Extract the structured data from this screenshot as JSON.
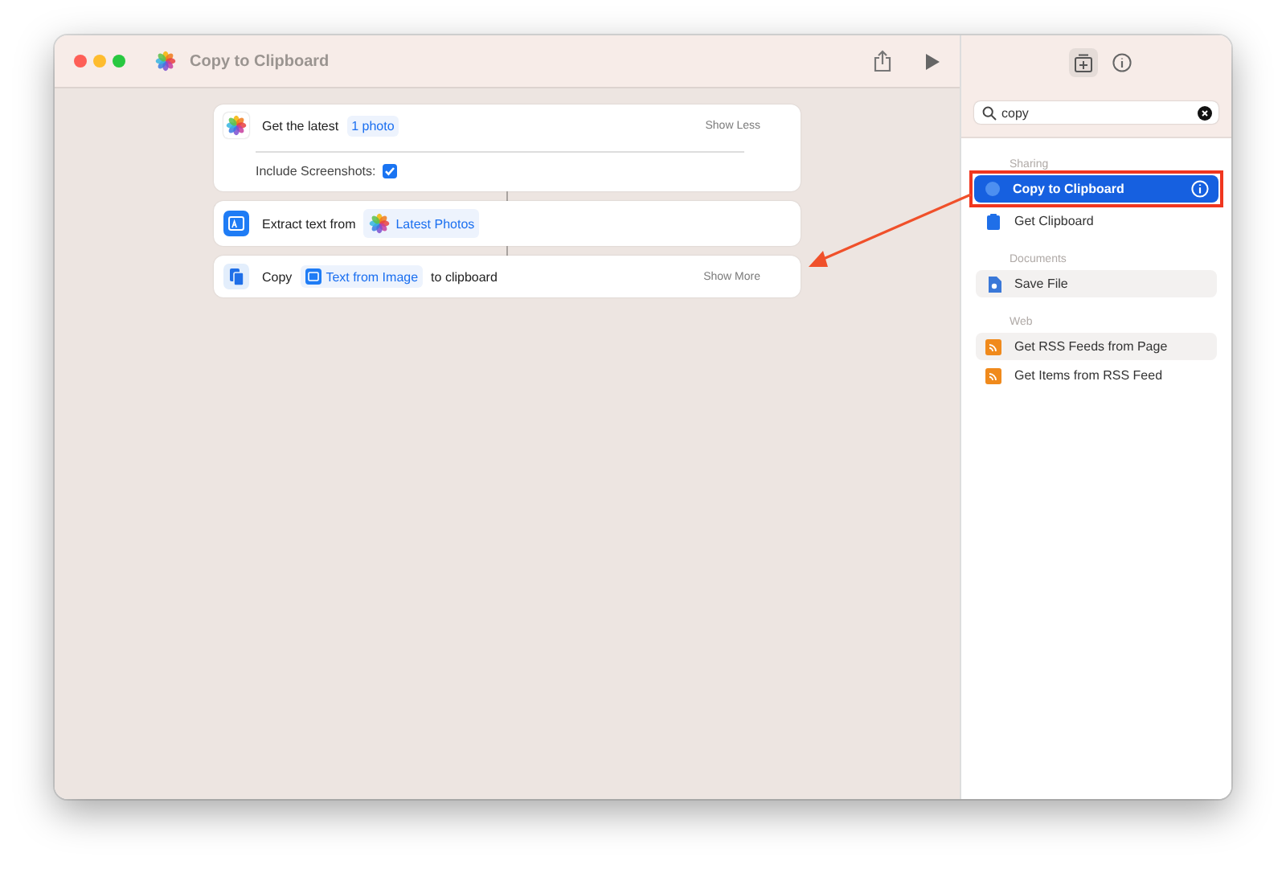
{
  "window": {
    "title": "Copy to Clipboard"
  },
  "actions": [
    {
      "kind": "photos",
      "parts": [
        {
          "kind": "text",
          "text": "Get the latest"
        },
        {
          "kind": "token",
          "text": "1 photo"
        }
      ],
      "toggle": "Show Less",
      "options": [
        {
          "label": "Include Screenshots:",
          "checked": true
        }
      ]
    },
    {
      "kind": "extract",
      "parts": [
        {
          "kind": "text",
          "text": "Extract text from"
        },
        {
          "kind": "photo-token",
          "text": "Latest Photos"
        }
      ]
    },
    {
      "kind": "copy",
      "parts": [
        {
          "kind": "text",
          "text": "Copy"
        },
        {
          "kind": "image-token",
          "text": "Text from Image"
        },
        {
          "kind": "text",
          "text": "to clipboard"
        }
      ],
      "toggle": "Show More"
    }
  ],
  "sidebar": {
    "search": {
      "value": "copy"
    },
    "groups": [
      {
        "title": "Sharing",
        "items": [
          {
            "label": "Copy to Clipboard",
            "kind": "copy",
            "selected": true,
            "shaded": false,
            "annotated": true
          },
          {
            "label": "Get Clipboard",
            "kind": "clipboard",
            "selected": false,
            "shaded": false,
            "annotated": false
          }
        ]
      },
      {
        "title": "Documents",
        "items": [
          {
            "label": "Save File",
            "kind": "file",
            "selected": false,
            "shaded": true,
            "annotated": false
          }
        ]
      },
      {
        "title": "Web",
        "items": [
          {
            "label": "Get RSS Feeds from Page",
            "kind": "rss",
            "selected": false,
            "shaded": true,
            "annotated": false
          },
          {
            "label": "Get Items from RSS Feed",
            "kind": "rss",
            "selected": false,
            "shaded": false,
            "annotated": false
          }
        ]
      }
    ]
  }
}
